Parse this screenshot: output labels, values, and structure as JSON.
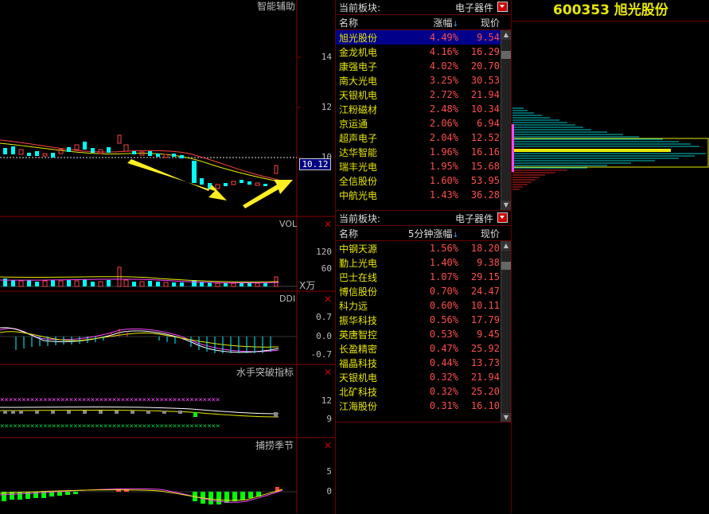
{
  "chart": {
    "main_title": "智能辅助",
    "price_axis": [
      "14",
      "12",
      "10"
    ],
    "current_price_tag": "10.12",
    "vol_label": "VOL",
    "vol_axis": [
      "120",
      "60"
    ],
    "vol_unit": "X万",
    "ddi_label": "DDI",
    "ddi_axis": [
      "0.7",
      "0.0",
      "-0.7"
    ],
    "ind3_label": "水手突破指标",
    "ind3_axis": [
      "12",
      "9"
    ],
    "ind4_label": "捕捞季节",
    "ind4_axis": [
      "5",
      "0"
    ],
    "close_icon": "close-icon"
  },
  "table1": {
    "board_label": "当前板块:",
    "board_value": "电子器件",
    "headers": {
      "name": "名称",
      "pct": "涨幅",
      "price": "现价"
    },
    "rows": [
      {
        "name": "旭光股份",
        "pct": "4.49%",
        "price": "9.54"
      },
      {
        "name": "金龙机电",
        "pct": "4.16%",
        "price": "16.29"
      },
      {
        "name": "康强电子",
        "pct": "4.02%",
        "price": "20.70"
      },
      {
        "name": "南大光电",
        "pct": "3.25%",
        "price": "30.53"
      },
      {
        "name": "天银机电",
        "pct": "2.72%",
        "price": "21.94"
      },
      {
        "name": "江粉磁材",
        "pct": "2.48%",
        "price": "10.34"
      },
      {
        "name": "京运通",
        "pct": "2.06%",
        "price": "6.94"
      },
      {
        "name": "超声电子",
        "pct": "2.04%",
        "price": "12.52"
      },
      {
        "name": "达华智能",
        "pct": "1.96%",
        "price": "16.16"
      },
      {
        "name": "瑞丰光电",
        "pct": "1.95%",
        "price": "15.68"
      },
      {
        "name": "全信股份",
        "pct": "1.60%",
        "price": "53.95"
      },
      {
        "name": "中航光电",
        "pct": "1.43%",
        "price": "36.28"
      }
    ]
  },
  "table2": {
    "board_label": "当前板块:",
    "board_value": "电子器件",
    "headers": {
      "name": "名称",
      "pct": "5分钟涨幅",
      "price": "现价"
    },
    "rows": [
      {
        "name": "中钢天源",
        "pct": "1.56%",
        "price": "18.20"
      },
      {
        "name": "勤上光电",
        "pct": "1.40%",
        "price": "9.38"
      },
      {
        "name": "巴士在线",
        "pct": "1.07%",
        "price": "29.15"
      },
      {
        "name": "博信股份",
        "pct": "0.70%",
        "price": "24.47"
      },
      {
        "name": "科力远",
        "pct": "0.60%",
        "price": "10.11"
      },
      {
        "name": "振华科技",
        "pct": "0.56%",
        "price": "17.79"
      },
      {
        "name": "英唐智控",
        "pct": "0.53%",
        "price": "9.45"
      },
      {
        "name": "长盈精密",
        "pct": "0.47%",
        "price": "25.92"
      },
      {
        "name": "福晶科技",
        "pct": "0.44%",
        "price": "13.73"
      },
      {
        "name": "天银机电",
        "pct": "0.32%",
        "price": "21.94"
      },
      {
        "name": "北矿科技",
        "pct": "0.32%",
        "price": "25.20"
      },
      {
        "name": "江海股份",
        "pct": "0.31%",
        "price": "16.10"
      }
    ]
  },
  "right": {
    "stock_title": "600353 旭光股份"
  },
  "colors": {
    "up": "#ff4d4d",
    "name": "#e8e800",
    "border": "#660000",
    "accent_blue": "#00008b"
  }
}
